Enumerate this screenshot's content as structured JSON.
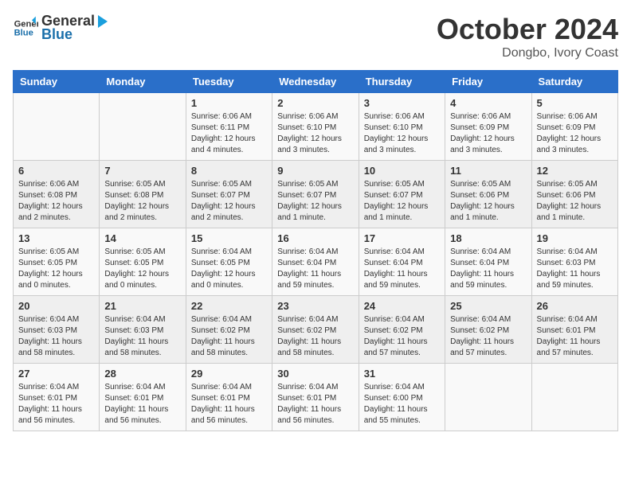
{
  "header": {
    "logo_line1": "General",
    "logo_line2": "Blue",
    "month": "October 2024",
    "location": "Dongbo, Ivory Coast"
  },
  "days_of_week": [
    "Sunday",
    "Monday",
    "Tuesday",
    "Wednesday",
    "Thursday",
    "Friday",
    "Saturday"
  ],
  "weeks": [
    [
      {
        "day": "",
        "info": ""
      },
      {
        "day": "",
        "info": ""
      },
      {
        "day": "1",
        "info": "Sunrise: 6:06 AM\nSunset: 6:11 PM\nDaylight: 12 hours and 4 minutes."
      },
      {
        "day": "2",
        "info": "Sunrise: 6:06 AM\nSunset: 6:10 PM\nDaylight: 12 hours and 3 minutes."
      },
      {
        "day": "3",
        "info": "Sunrise: 6:06 AM\nSunset: 6:10 PM\nDaylight: 12 hours and 3 minutes."
      },
      {
        "day": "4",
        "info": "Sunrise: 6:06 AM\nSunset: 6:09 PM\nDaylight: 12 hours and 3 minutes."
      },
      {
        "day": "5",
        "info": "Sunrise: 6:06 AM\nSunset: 6:09 PM\nDaylight: 12 hours and 3 minutes."
      }
    ],
    [
      {
        "day": "6",
        "info": "Sunrise: 6:06 AM\nSunset: 6:08 PM\nDaylight: 12 hours and 2 minutes."
      },
      {
        "day": "7",
        "info": "Sunrise: 6:05 AM\nSunset: 6:08 PM\nDaylight: 12 hours and 2 minutes."
      },
      {
        "day": "8",
        "info": "Sunrise: 6:05 AM\nSunset: 6:07 PM\nDaylight: 12 hours and 2 minutes."
      },
      {
        "day": "9",
        "info": "Sunrise: 6:05 AM\nSunset: 6:07 PM\nDaylight: 12 hours and 1 minute."
      },
      {
        "day": "10",
        "info": "Sunrise: 6:05 AM\nSunset: 6:07 PM\nDaylight: 12 hours and 1 minute."
      },
      {
        "day": "11",
        "info": "Sunrise: 6:05 AM\nSunset: 6:06 PM\nDaylight: 12 hours and 1 minute."
      },
      {
        "day": "12",
        "info": "Sunrise: 6:05 AM\nSunset: 6:06 PM\nDaylight: 12 hours and 1 minute."
      }
    ],
    [
      {
        "day": "13",
        "info": "Sunrise: 6:05 AM\nSunset: 6:05 PM\nDaylight: 12 hours and 0 minutes."
      },
      {
        "day": "14",
        "info": "Sunrise: 6:05 AM\nSunset: 6:05 PM\nDaylight: 12 hours and 0 minutes."
      },
      {
        "day": "15",
        "info": "Sunrise: 6:04 AM\nSunset: 6:05 PM\nDaylight: 12 hours and 0 minutes."
      },
      {
        "day": "16",
        "info": "Sunrise: 6:04 AM\nSunset: 6:04 PM\nDaylight: 11 hours and 59 minutes."
      },
      {
        "day": "17",
        "info": "Sunrise: 6:04 AM\nSunset: 6:04 PM\nDaylight: 11 hours and 59 minutes."
      },
      {
        "day": "18",
        "info": "Sunrise: 6:04 AM\nSunset: 6:04 PM\nDaylight: 11 hours and 59 minutes."
      },
      {
        "day": "19",
        "info": "Sunrise: 6:04 AM\nSunset: 6:03 PM\nDaylight: 11 hours and 59 minutes."
      }
    ],
    [
      {
        "day": "20",
        "info": "Sunrise: 6:04 AM\nSunset: 6:03 PM\nDaylight: 11 hours and 58 minutes."
      },
      {
        "day": "21",
        "info": "Sunrise: 6:04 AM\nSunset: 6:03 PM\nDaylight: 11 hours and 58 minutes."
      },
      {
        "day": "22",
        "info": "Sunrise: 6:04 AM\nSunset: 6:02 PM\nDaylight: 11 hours and 58 minutes."
      },
      {
        "day": "23",
        "info": "Sunrise: 6:04 AM\nSunset: 6:02 PM\nDaylight: 11 hours and 58 minutes."
      },
      {
        "day": "24",
        "info": "Sunrise: 6:04 AM\nSunset: 6:02 PM\nDaylight: 11 hours and 57 minutes."
      },
      {
        "day": "25",
        "info": "Sunrise: 6:04 AM\nSunset: 6:02 PM\nDaylight: 11 hours and 57 minutes."
      },
      {
        "day": "26",
        "info": "Sunrise: 6:04 AM\nSunset: 6:01 PM\nDaylight: 11 hours and 57 minutes."
      }
    ],
    [
      {
        "day": "27",
        "info": "Sunrise: 6:04 AM\nSunset: 6:01 PM\nDaylight: 11 hours and 56 minutes."
      },
      {
        "day": "28",
        "info": "Sunrise: 6:04 AM\nSunset: 6:01 PM\nDaylight: 11 hours and 56 minutes."
      },
      {
        "day": "29",
        "info": "Sunrise: 6:04 AM\nSunset: 6:01 PM\nDaylight: 11 hours and 56 minutes."
      },
      {
        "day": "30",
        "info": "Sunrise: 6:04 AM\nSunset: 6:01 PM\nDaylight: 11 hours and 56 minutes."
      },
      {
        "day": "31",
        "info": "Sunrise: 6:04 AM\nSunset: 6:00 PM\nDaylight: 11 hours and 55 minutes."
      },
      {
        "day": "",
        "info": ""
      },
      {
        "day": "",
        "info": ""
      }
    ]
  ]
}
